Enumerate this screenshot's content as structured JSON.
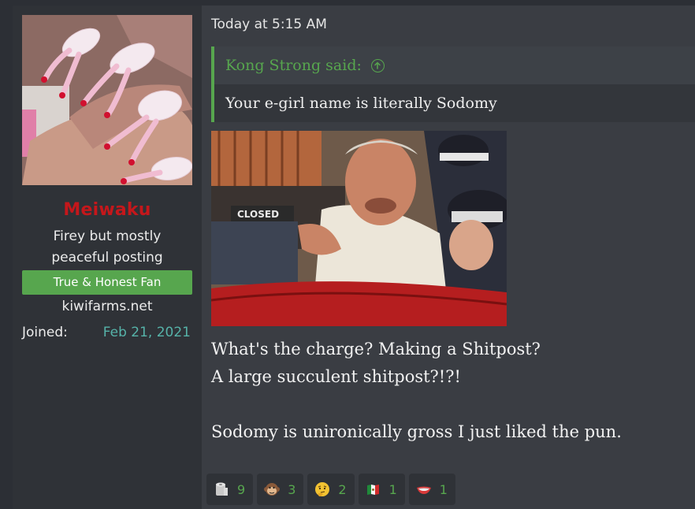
{
  "post": {
    "timestamp": "Today at 5:15 AM",
    "quote": {
      "author_line": "Kong Strong said:",
      "text": "Your e-girl name is literally Sodomy"
    },
    "meme_caption": "CLOSED",
    "body_lines": [
      "What's the charge? Making a Shitpost?",
      "A large succulent shitpost?!?!",
      "",
      "Sodomy is unironically gross I just liked the pun."
    ]
  },
  "user": {
    "name": "Meiwaku",
    "title_line1": "Firey but mostly",
    "title_line2": "peaceful posting",
    "banner": "True & Honest Fan",
    "site": "kiwifarms.net",
    "joined_label": "Joined:",
    "joined_date": "Feb 21, 2021",
    "avatar_icon": "long-nails-avatar",
    "name_color": "#c5171b"
  },
  "reactions": [
    {
      "icon": "toilet-paper-icon",
      "count": "9"
    },
    {
      "icon": "monkey-face-icon",
      "count": "3"
    },
    {
      "icon": "thinking-face-icon",
      "count": "2"
    },
    {
      "icon": "mexico-flag-icon",
      "count": "1"
    },
    {
      "icon": "smile-lips-icon",
      "count": "1"
    }
  ],
  "colors": {
    "accent_green": "#57a64e",
    "date_teal": "#56b3a9",
    "background": "#2c2f35",
    "panel": "#3a3d43"
  }
}
